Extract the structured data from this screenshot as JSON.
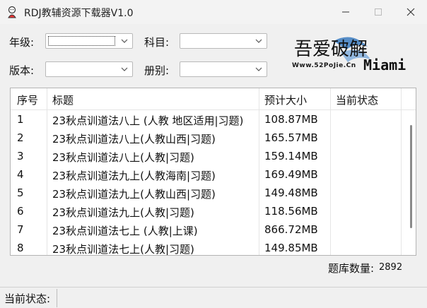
{
  "window": {
    "title": "RDJ教辅资源下载器V1.0"
  },
  "filters": {
    "grade_label": "年级:",
    "subject_label": "科目:",
    "edition_label": "版本:",
    "volume_label": "册别:",
    "grade_value": "",
    "subject_value": "",
    "edition_value": "",
    "volume_value": ""
  },
  "logo": {
    "text": "吾爱破解",
    "sub": "Www.52PoJie.Cn",
    "name": "Miami"
  },
  "table": {
    "columns": [
      "序号",
      "标题",
      "预计大小",
      "当前状态"
    ],
    "rows": [
      {
        "no": "1",
        "title": "23秋点训道法八上 (人教 地区适用|习题)",
        "size": "108.87MB",
        "status": ""
      },
      {
        "no": "2",
        "title": "23秋点训道法八上(人教山西|习题)",
        "size": "165.57MB",
        "status": ""
      },
      {
        "no": "3",
        "title": "23秋点训道法八上(人教|习题)",
        "size": "159.14MB",
        "status": ""
      },
      {
        "no": "4",
        "title": "23秋点训道法九上(人教海南|习题)",
        "size": "169.49MB",
        "status": ""
      },
      {
        "no": "5",
        "title": "23秋点训道法九上(人教山西|习题)",
        "size": "149.48MB",
        "status": ""
      },
      {
        "no": "6",
        "title": "23秋点训道法九上(人教|习题)",
        "size": "118.56MB",
        "status": ""
      },
      {
        "no": "7",
        "title": "23秋点训道法七上 (人教|上课)",
        "size": "866.72MB",
        "status": ""
      },
      {
        "no": "8",
        "title": "23秋点训道法七上(人教|习题)",
        "size": "149.85MB",
        "status": ""
      }
    ]
  },
  "footer": {
    "count_label": "题库数量:",
    "count_value": "2892"
  },
  "statusbar": {
    "label": "当前状态:"
  },
  "colors": {
    "window_bg": "#f0f0f0",
    "table_bg": "#ffffff",
    "border": "#b4b4b4"
  }
}
